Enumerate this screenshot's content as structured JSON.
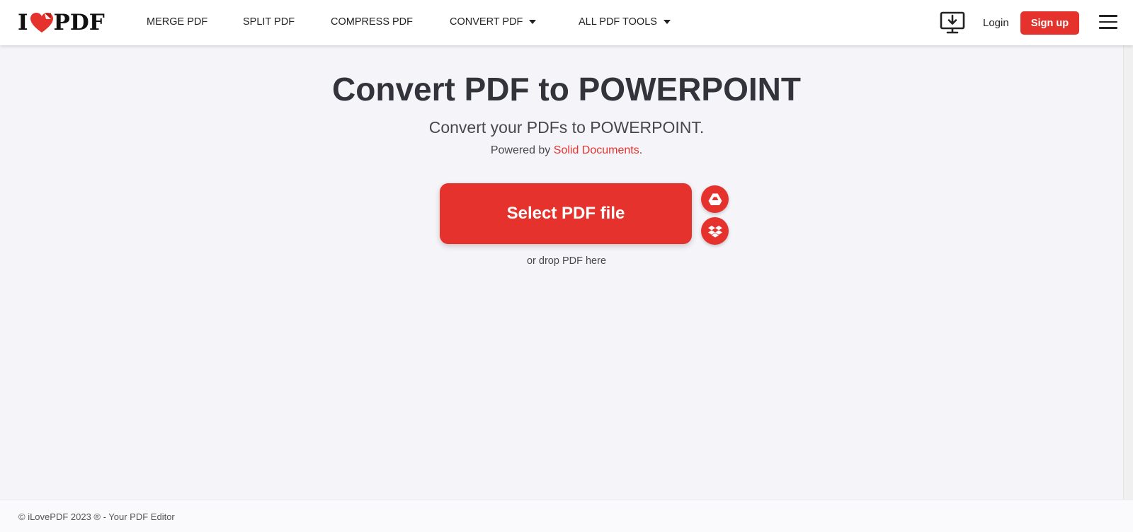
{
  "header": {
    "logo": {
      "left": "I",
      "right": "PDF"
    },
    "nav": [
      {
        "label": "MERGE PDF"
      },
      {
        "label": "SPLIT PDF"
      },
      {
        "label": "COMPRESS PDF"
      },
      {
        "label": "CONVERT PDF",
        "has_caret": true
      },
      {
        "label": "ALL PDF TOOLS",
        "has_caret": true
      }
    ],
    "login_label": "Login",
    "signup_label": "Sign up"
  },
  "main": {
    "title": "Convert PDF to POWERPOINT",
    "subtitle": "Convert your PDFs to POWERPOINT.",
    "powered_prefix": "Powered by",
    "powered_link": "Solid Documents",
    "powered_suffix": ".",
    "select_button": "Select PDF file",
    "drop_hint": "or drop PDF here",
    "cloud_sources": [
      {
        "icon": "google-drive-icon"
      },
      {
        "icon": "dropbox-icon"
      }
    ]
  },
  "footer": {
    "copyright": "© iLovePDF 2023 ® - Your PDF Editor"
  },
  "colors": {
    "brand_red": "#e5322d",
    "page_background": "#f4f4f9",
    "text_dark": "#33333b"
  }
}
